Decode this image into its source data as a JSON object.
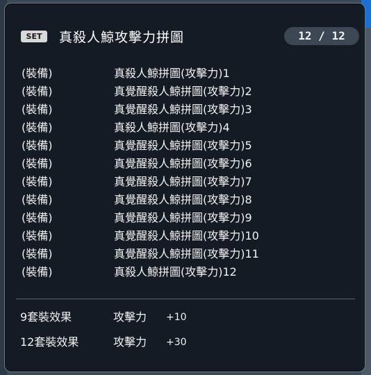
{
  "tooltip": {
    "badge": "SET",
    "title": "真殺人鯨攻擊力拼圖",
    "count": "12 / 12",
    "items": [
      {
        "type": "(裝備)",
        "name": "真殺人鯨拼圖(攻擊力)1"
      },
      {
        "type": "(裝備)",
        "name": "真覺醒殺人鯨拼圖(攻擊力)2"
      },
      {
        "type": "(裝備)",
        "name": "真覺醒殺人鯨拼圖(攻擊力)3"
      },
      {
        "type": "(裝備)",
        "name": "真殺人鯨拼圖(攻擊力)4"
      },
      {
        "type": "(裝備)",
        "name": "真覺醒殺人鯨拼圖(攻擊力)5"
      },
      {
        "type": "(裝備)",
        "name": "真覺醒殺人鯨拼圖(攻擊力)6"
      },
      {
        "type": "(裝備)",
        "name": "真覺醒殺人鯨拼圖(攻擊力)7"
      },
      {
        "type": "(裝備)",
        "name": "真覺醒殺人鯨拼圖(攻擊力)8"
      },
      {
        "type": "(裝備)",
        "name": "真覺醒殺人鯨拼圖(攻擊力)9"
      },
      {
        "type": "(裝備)",
        "name": "真覺醒殺人鯨拼圖(攻擊力)10"
      },
      {
        "type": "(裝備)",
        "name": "真覺醒殺人鯨拼圖(攻擊力)11"
      },
      {
        "type": "(裝備)",
        "name": "真殺人鯨拼圖(攻擊力)12"
      }
    ],
    "effects": [
      {
        "label": "9套裝效果",
        "stat": "攻擊力",
        "value": "+10"
      },
      {
        "label": "12套裝效果",
        "stat": "攻擊力",
        "value": "+30"
      }
    ]
  },
  "colors": {
    "background": "#121820",
    "border": "#6f7c88",
    "text": "#f2f2f2",
    "badge": "#d9d9d9",
    "pill": "#3d4753"
  }
}
